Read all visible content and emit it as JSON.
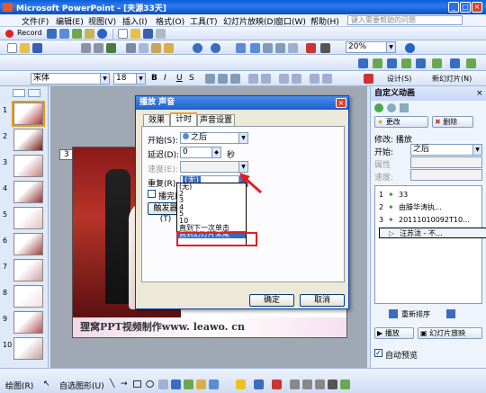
{
  "window": {
    "title": "Microsoft PowerPoint - [夹源33天]"
  },
  "menu": {
    "items": [
      "文件(F)",
      "编辑(E)",
      "视图(V)",
      "插入(I)",
      "格式(O)",
      "工具(T)",
      "幻灯片放映(D)",
      "窗口(W)",
      "帮助(H)"
    ],
    "help_placeholder": "键入需要帮助的问题"
  },
  "toolbar1": {
    "record_label": "Record"
  },
  "toolbar2": {
    "zoom": "20%"
  },
  "formatting": {
    "font": "宋体",
    "size": "18",
    "bold": "B",
    "italic": "I",
    "underline": "U",
    "shadow": "S",
    "design_label": "设计(S)",
    "new_slide_label": "新幻灯片(N)"
  },
  "slides": {
    "numbers": [
      "1",
      "2",
      "3",
      "4",
      "5",
      "6",
      "7",
      "8",
      "9",
      "10"
    ],
    "current_page_marker": "3"
  },
  "slide": {
    "footer_text": "狸窝PPT视频制作www. leawo. cn"
  },
  "dialog": {
    "title": "播放 声音",
    "tabs": [
      "效果",
      "计时",
      "声音设置"
    ],
    "start_label": "开始(S):",
    "start_value": "之后",
    "delay_label": "延迟(D):",
    "delay_value": "0",
    "delay_unit": "秒",
    "speed_label": "速度(E):",
    "repeat_label": "重复(R):",
    "repeat_value": "(无)",
    "rewind_label": "播完后快退",
    "trigger_label": "触发器(T)",
    "dropdown_options": [
      "(无)",
      "2",
      "3",
      "4",
      "5",
      "10",
      "直到下一次单击",
      "直到幻灯片末尾"
    ],
    "selected_index": 7,
    "ok": "确定",
    "cancel": "取消"
  },
  "taskpane": {
    "title": "自定义动画",
    "change_label": "更改",
    "delete_label": "删除",
    "modify_label": "修改: 播放",
    "start_label": "开始:",
    "start_value": "之后",
    "property_label": "属性",
    "speed_label": "速度:",
    "items": [
      {
        "num": "1",
        "text": "33"
      },
      {
        "num": "2",
        "text": "由滕华涛执..."
      },
      {
        "num": "3",
        "text": "20111010092T10..."
      },
      {
        "num": "",
        "text": "汪苏泷 - 不..."
      }
    ],
    "reorder_label": "重新排序",
    "play_label": "播放",
    "slideshow_label": "幻灯片放映",
    "autopreview_label": "自动预览"
  },
  "statusbar": {
    "draw_label": "绘图(R)",
    "autoshape_label": "自选图形(U)"
  }
}
